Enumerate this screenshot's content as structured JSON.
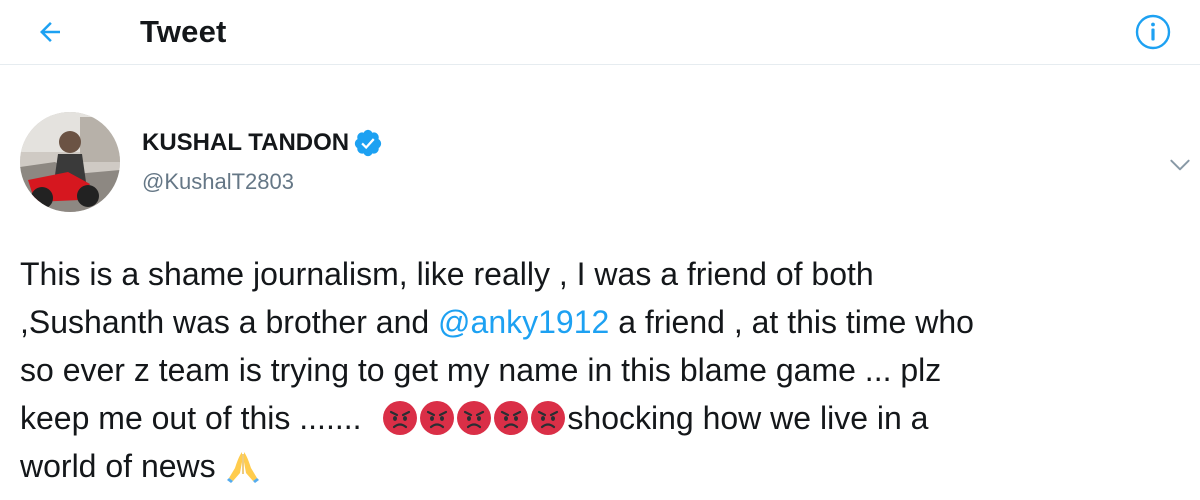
{
  "header": {
    "title": "Tweet",
    "back_icon": "arrow-left-icon",
    "info_icon": "info-circle-icon",
    "accent_color": "#1da1f2"
  },
  "tweet": {
    "author_name": "KUSHAL TANDON",
    "author_handle": "@KushalT2803",
    "verified": true,
    "text": {
      "line1": "This is a shame journalism, like really , I was a friend of both",
      "line2_pre": ",Sushanth was a brother and ",
      "mention": "@anky1912",
      "line2_post": " a friend , at this time who",
      "line3": "so ever z team is trying to get my name in this blame game ... plz",
      "line4_pre": "keep me out of this ....... ",
      "line4_post": "shocking how we live in a",
      "line5": "world of news "
    },
    "emojis": {
      "angry_face_count": 5,
      "angry_face": "angry-face-icon",
      "folded_hands": "folded-hands-icon"
    }
  }
}
